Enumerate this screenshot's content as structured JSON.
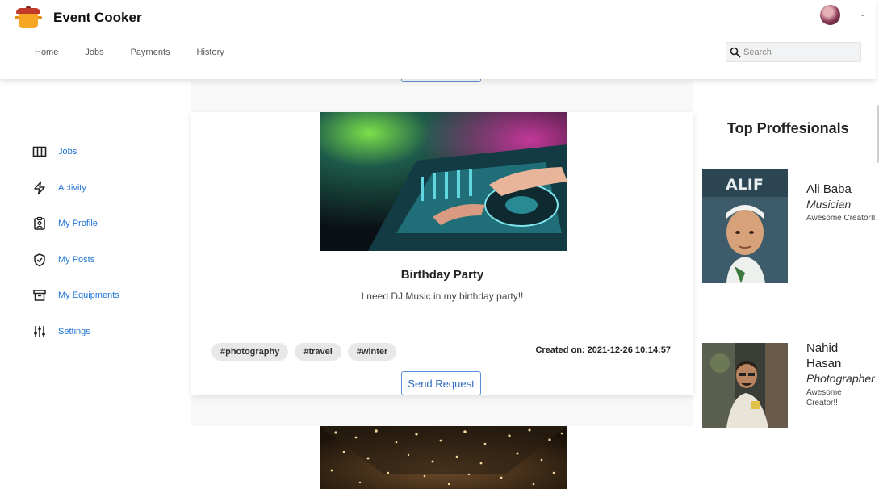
{
  "header": {
    "app_name": "Event Cooker",
    "nav": [
      "Home",
      "Jobs",
      "Payments",
      "History"
    ],
    "search_placeholder": "Search"
  },
  "sidebar": {
    "items": [
      {
        "label": "Jobs",
        "icon": "columns-icon"
      },
      {
        "label": "Activity",
        "icon": "lightning-icon"
      },
      {
        "label": "My Profile",
        "icon": "profile-clipboard-icon"
      },
      {
        "label": "My Posts",
        "icon": "shield-check-icon"
      },
      {
        "label": "My Equipments",
        "icon": "archive-box-icon"
      },
      {
        "label": "Settings",
        "icon": "sliders-icon"
      }
    ]
  },
  "post": {
    "image": "dj-mixer-photo",
    "title": "Birthday Party",
    "description": "I need DJ Music in my birthday party!!",
    "tags": [
      "#photography",
      "#travel",
      "#winter"
    ],
    "created": "Created on: 2021-12-26 10:14:57",
    "action": "Send Request"
  },
  "next_post": {
    "image": "fairy-lights-photo"
  },
  "professionals": {
    "title": "Top Proffesionals",
    "items": [
      {
        "name": "Ali Baba",
        "role": "Musician",
        "note": "Awesome Creator!!",
        "photo": "alif-poster-photo",
        "poster_text": "ALIF"
      },
      {
        "name": "Nahid Hasan",
        "role": "Photographer",
        "note": "Awesome Creator!!",
        "photo": "man-portrait-photo"
      }
    ]
  },
  "colors": {
    "accent": "#1e73d6",
    "button_border": "#5b8fd6",
    "tag_bg": "#e8e8e8"
  }
}
